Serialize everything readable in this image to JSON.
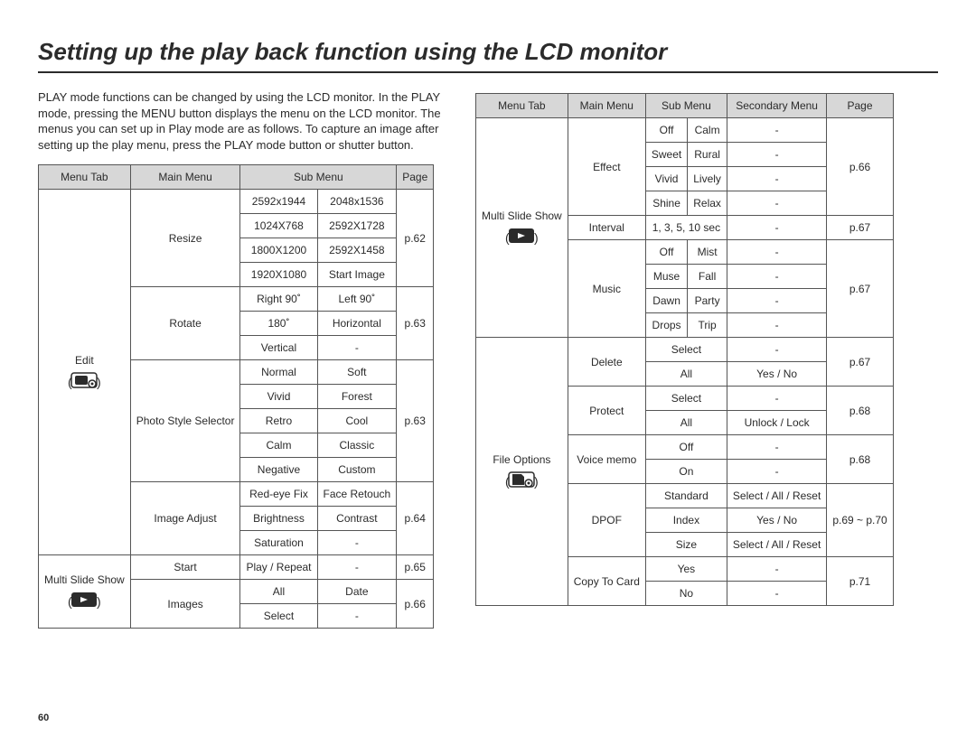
{
  "title": "Setting up the play back function using the LCD monitor",
  "intro": "PLAY mode functions can be changed by using the LCD monitor. In the PLAY mode, pressing the MENU button displays the menu on the LCD monitor. The menus you can set up in Play mode are as follows. To capture an image after setting up the play menu, press the PLAY mode button or shutter button.",
  "pageNumber": "60",
  "leftHeader": {
    "c1": "Menu Tab",
    "c2": "Main Menu",
    "c3": "Sub Menu",
    "c4": "Page"
  },
  "rightHeader": {
    "c1": "Menu Tab",
    "c2": "Main Menu",
    "c3": "Sub Menu",
    "c4": "Secondary Menu",
    "c5": "Page"
  },
  "left": {
    "tab1": "Edit",
    "main1": "Resize",
    "resize": [
      [
        "2592x1944",
        "2048x1536"
      ],
      [
        "1024X768",
        "2592X1728"
      ],
      [
        "1800X1200",
        "2592X1458"
      ],
      [
        "1920X1080",
        "Start Image"
      ]
    ],
    "pResize": "p.62",
    "main2": "Rotate",
    "rotate": [
      [
        "Right 90˚",
        "Left 90˚"
      ],
      [
        "180˚",
        "Horizontal"
      ],
      [
        "Vertical",
        "-"
      ]
    ],
    "pRotate": "p.63",
    "main3": "Photo Style Selector",
    "style": [
      [
        "Normal",
        "Soft"
      ],
      [
        "Vivid",
        "Forest"
      ],
      [
        "Retro",
        "Cool"
      ],
      [
        "Calm",
        "Classic"
      ],
      [
        "Negative",
        "Custom"
      ]
    ],
    "pStyle": "p.63",
    "main4": "Image Adjust",
    "adjust": [
      [
        "Red-eye Fix",
        "Face Retouch"
      ],
      [
        "Brightness",
        "Contrast"
      ],
      [
        "Saturation",
        "-"
      ]
    ],
    "pAdjust": "p.64",
    "tab2": "Multi Slide Show",
    "main5": "Start",
    "start": [
      [
        "Play / Repeat",
        "-"
      ]
    ],
    "pStart": "p.65",
    "main6": "Images",
    "images": [
      [
        "All",
        "Date"
      ],
      [
        "Select",
        "-"
      ]
    ],
    "pImages": "p.66"
  },
  "right": {
    "tab1": "Multi Slide Show",
    "main1": "Effect",
    "effect": [
      [
        "Off",
        "Calm",
        "-"
      ],
      [
        "Sweet",
        "Rural",
        "-"
      ],
      [
        "Vivid",
        "Lively",
        "-"
      ],
      [
        "Shine",
        "Relax",
        "-"
      ]
    ],
    "pEffect": "p.66",
    "main2": "Interval",
    "interval": [
      [
        "1, 3, 5, 10 sec",
        "-"
      ]
    ],
    "pInterval": "p.67",
    "main3": "Music",
    "music": [
      [
        "Off",
        "Mist",
        "-"
      ],
      [
        "Muse",
        "Fall",
        "-"
      ],
      [
        "Dawn",
        "Party",
        "-"
      ],
      [
        "Drops",
        "Trip",
        "-"
      ]
    ],
    "pMusic": "p.67",
    "tab2": "File Options",
    "main4": "Delete",
    "delete": [
      [
        "Select",
        "-"
      ],
      [
        "All",
        "Yes / No"
      ]
    ],
    "pDelete": "p.67",
    "main5": "Protect",
    "protect": [
      [
        "Select",
        "-"
      ],
      [
        "All",
        "Unlock / Lock"
      ]
    ],
    "pProtect": "p.68",
    "main6": "Voice memo",
    "voice": [
      [
        "Off",
        "-"
      ],
      [
        "On",
        "-"
      ]
    ],
    "pVoice": "p.68",
    "main7": "DPOF",
    "dpof": [
      [
        "Standard",
        "Select / All / Reset"
      ],
      [
        "Index",
        "Yes / No"
      ],
      [
        "Size",
        "Select / All / Reset"
      ]
    ],
    "pDpof": "p.69 ~ p.70",
    "main8": "Copy To Card",
    "copy": [
      [
        "Yes",
        "-"
      ],
      [
        "No",
        "-"
      ]
    ],
    "pCopy": "p.71"
  }
}
